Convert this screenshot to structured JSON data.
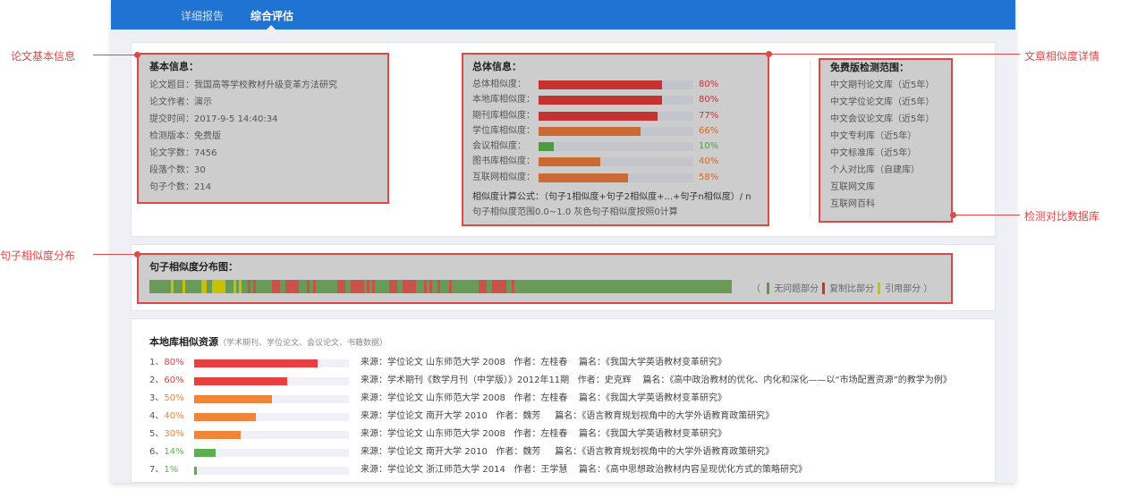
{
  "tabs": [
    {
      "label": "详细报告"
    },
    {
      "label": "综合评估"
    }
  ],
  "annotations": {
    "basic": "论文基本信息",
    "similarity": "文章相似度详情",
    "database": "检测对比数据库",
    "distribution": "句子相似度分布"
  },
  "basic": {
    "title": "基本信息：",
    "lines": [
      "论文题目：我国高等学校教材升级变革方法研究",
      "论文作者：演示",
      "提交时间：2017-9-5 14:40:34",
      "检测版本：免费版",
      "论文字数：7456",
      "段落个数：30",
      "句子个数：214"
    ]
  },
  "overall": {
    "title": "总体信息：",
    "items": [
      {
        "label": "总体相似度：",
        "value": 80,
        "text": "80%",
        "color": "#c53232"
      },
      {
        "label": "本地库相似度：",
        "value": 80,
        "text": "80%",
        "color": "#c53232"
      },
      {
        "label": "期刊库相似度：",
        "value": 77,
        "text": "77%",
        "color": "#c53232"
      },
      {
        "label": "学位库相似度：",
        "value": 66,
        "text": "66%",
        "color": "#cc6a33"
      },
      {
        "label": "会议相似度：",
        "value": 10,
        "text": "10%",
        "color": "#4d9a45"
      },
      {
        "label": "图书库相似度：",
        "value": 40,
        "text": "40%",
        "color": "#cc6a33"
      },
      {
        "label": "互联网相似度：",
        "value": 58,
        "text": "58%",
        "color": "#cc6a33"
      }
    ],
    "formula_label": "相似度计算公式：",
    "formula": "（句子1相似度+句子2相似度+...+句子n相似度）/ n",
    "note": "句子相似度范围0.0~1.0 灰色句子相似度按照0计算"
  },
  "scope": {
    "title": "免费版检测范围：",
    "items": [
      "中文期刊论文库（近5年）",
      "中文学位论文库（近5年）",
      "中文会议论文库（近5年）",
      "中文专利库（近5年）",
      "中文标准库（近5年）",
      "个人对比库（自建库）",
      "互联网文库",
      "互联网百科"
    ]
  },
  "distribution": {
    "title": "句子相似度分布图：",
    "total": 214,
    "segments": [
      [
        "y",
        8,
        1
      ],
      [
        "y",
        12,
        1
      ],
      [
        "y",
        19,
        2
      ],
      [
        "y",
        23,
        5
      ],
      [
        "y",
        31,
        1
      ],
      [
        "y",
        33,
        1
      ],
      [
        "r",
        36,
        1
      ],
      [
        "r",
        38,
        1
      ],
      [
        "r",
        45,
        3
      ],
      [
        "r",
        50,
        5
      ],
      [
        "r",
        58,
        1
      ],
      [
        "r",
        60,
        1
      ],
      [
        "r",
        69,
        3
      ],
      [
        "r",
        74,
        5
      ],
      [
        "r",
        80,
        1
      ],
      [
        "r",
        82,
        1
      ],
      [
        "r",
        88,
        3
      ],
      [
        "r",
        93,
        5
      ],
      [
        "r",
        101,
        1
      ],
      [
        "r",
        103,
        1
      ],
      [
        "r",
        106,
        1
      ],
      [
        "r",
        110,
        1
      ],
      [
        "r",
        121,
        3
      ],
      [
        "r",
        126,
        5
      ],
      [
        "r",
        133,
        1
      ]
    ],
    "legend_open": "（",
    "legend": [
      {
        "label": "无问题部分",
        "color": "#5b9a4c"
      },
      {
        "label": "复制比部分",
        "color": "#c53232"
      },
      {
        "label": "引用部分",
        "color": "#c8c000"
      }
    ],
    "legend_close": "）",
    "colors": {
      "g": "#6a9a58",
      "r": "#c9524a",
      "y": "#c8c000"
    }
  },
  "sources": {
    "title": "本地库相似资源",
    "subtitle": "（学术期刊、学位论文、会议论文、书籍数据）",
    "items": [
      {
        "index": "1、",
        "pct": 80,
        "text": "80%",
        "color": "#e84040",
        "source": "来源：学位论文 山东师范大学 2008   作者：左桂春    篇名：《我国大学英语教材变革研究》"
      },
      {
        "index": "2、",
        "pct": 60,
        "text": "60%",
        "color": "#e84040",
        "source": "来源：学术期刊《数学月刊（中学版）》2012年11期   作者：史克辉    篇名：《高中政治教材的优化、内化和深化——以“市场配置资源”的教学为例》"
      },
      {
        "index": "3、",
        "pct": 50,
        "text": "50%",
        "color": "#f08438",
        "source": "来源：学位论文 山东师范大学 2008   作者：左桂春    篇名：《我国大学英语教材变革研究》"
      },
      {
        "index": "4、",
        "pct": 40,
        "text": "40%",
        "color": "#f08438",
        "source": "来源：学位论文 南开大学 2010   作者：魏芳     篇名：《语言教育规划视角中的大学外语教育政策研究》"
      },
      {
        "index": "5、",
        "pct": 30,
        "text": "30%",
        "color": "#f08438",
        "source": "来源：学位论文 山东师范大学 2008   作者：左桂春    篇名：《我国大学英语教材变革研究》"
      },
      {
        "index": "6、",
        "pct": 14,
        "text": "14%",
        "color": "#5cb050",
        "source": "来源：学位论文 南开大学 2010   作者：魏芳     篇名：《语言教育规划视角中的大学外语教育政策研究》"
      },
      {
        "index": "7、",
        "pct": 1,
        "text": "1%",
        "color": "#5cb050",
        "source": "来源：学位论文 浙江师范大学 2014   作者：王学慧    篇名：《高中思想政治教材内容呈现优化方式的策略研究》"
      }
    ]
  }
}
